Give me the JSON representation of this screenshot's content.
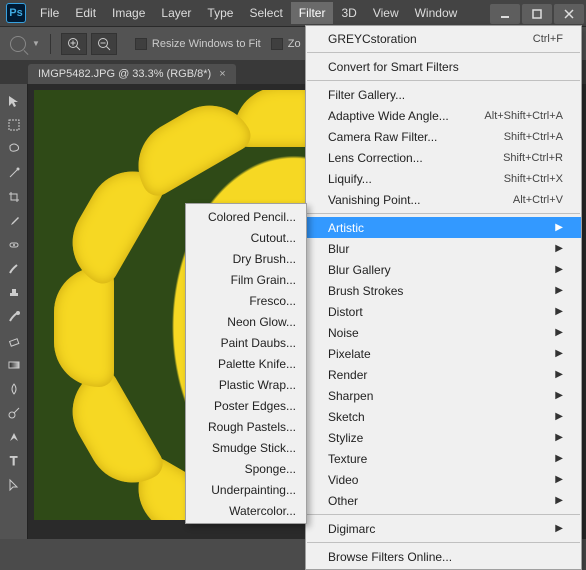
{
  "app": {
    "logo_text": "Ps"
  },
  "menubar": [
    "File",
    "Edit",
    "Image",
    "Layer",
    "Type",
    "Select",
    "Filter",
    "3D",
    "View",
    "Window"
  ],
  "menubar_active_index": 6,
  "optionsbar": {
    "resize_label": "Resize Windows to Fit",
    "zoom_label": "Zo"
  },
  "document_tab": {
    "title": "IMGP5482.JPG @ 33.3% (RGB/8*)",
    "close_glyph": "×"
  },
  "filter_menu": {
    "top_item": {
      "label": "GREYCstoration",
      "shortcut": "Ctrl+F"
    },
    "convert_label": "Convert for Smart Filters",
    "main_items": [
      {
        "label": "Filter Gallery...",
        "shortcut": ""
      },
      {
        "label": "Adaptive Wide Angle...",
        "shortcut": "Alt+Shift+Ctrl+A"
      },
      {
        "label": "Camera Raw Filter...",
        "shortcut": "Shift+Ctrl+A"
      },
      {
        "label": "Lens Correction...",
        "shortcut": "Shift+Ctrl+R"
      },
      {
        "label": "Liquify...",
        "shortcut": "Shift+Ctrl+X"
      },
      {
        "label": "Vanishing Point...",
        "shortcut": "Alt+Ctrl+V"
      }
    ],
    "categories": [
      "Artistic",
      "Blur",
      "Blur Gallery",
      "Brush Strokes",
      "Distort",
      "Noise",
      "Pixelate",
      "Render",
      "Sharpen",
      "Sketch",
      "Stylize",
      "Texture",
      "Video",
      "Other"
    ],
    "highlight_index": 0,
    "digimarc_label": "Digimarc",
    "browse_label": "Browse Filters Online..."
  },
  "artistic_submenu": [
    "Colored Pencil...",
    "Cutout...",
    "Dry Brush...",
    "Film Grain...",
    "Fresco...",
    "Neon Glow...",
    "Paint Daubs...",
    "Palette Knife...",
    "Plastic Wrap...",
    "Poster Edges...",
    "Rough Pastels...",
    "Smudge Stick...",
    "Sponge...",
    "Underpainting...",
    "Watercolor..."
  ],
  "tools": [
    "move",
    "marquee",
    "lasso",
    "wand",
    "crop",
    "eyedropper",
    "heal",
    "brush",
    "stamp",
    "history",
    "eraser",
    "gradient",
    "blur",
    "dodge",
    "pen",
    "type",
    "path"
  ]
}
